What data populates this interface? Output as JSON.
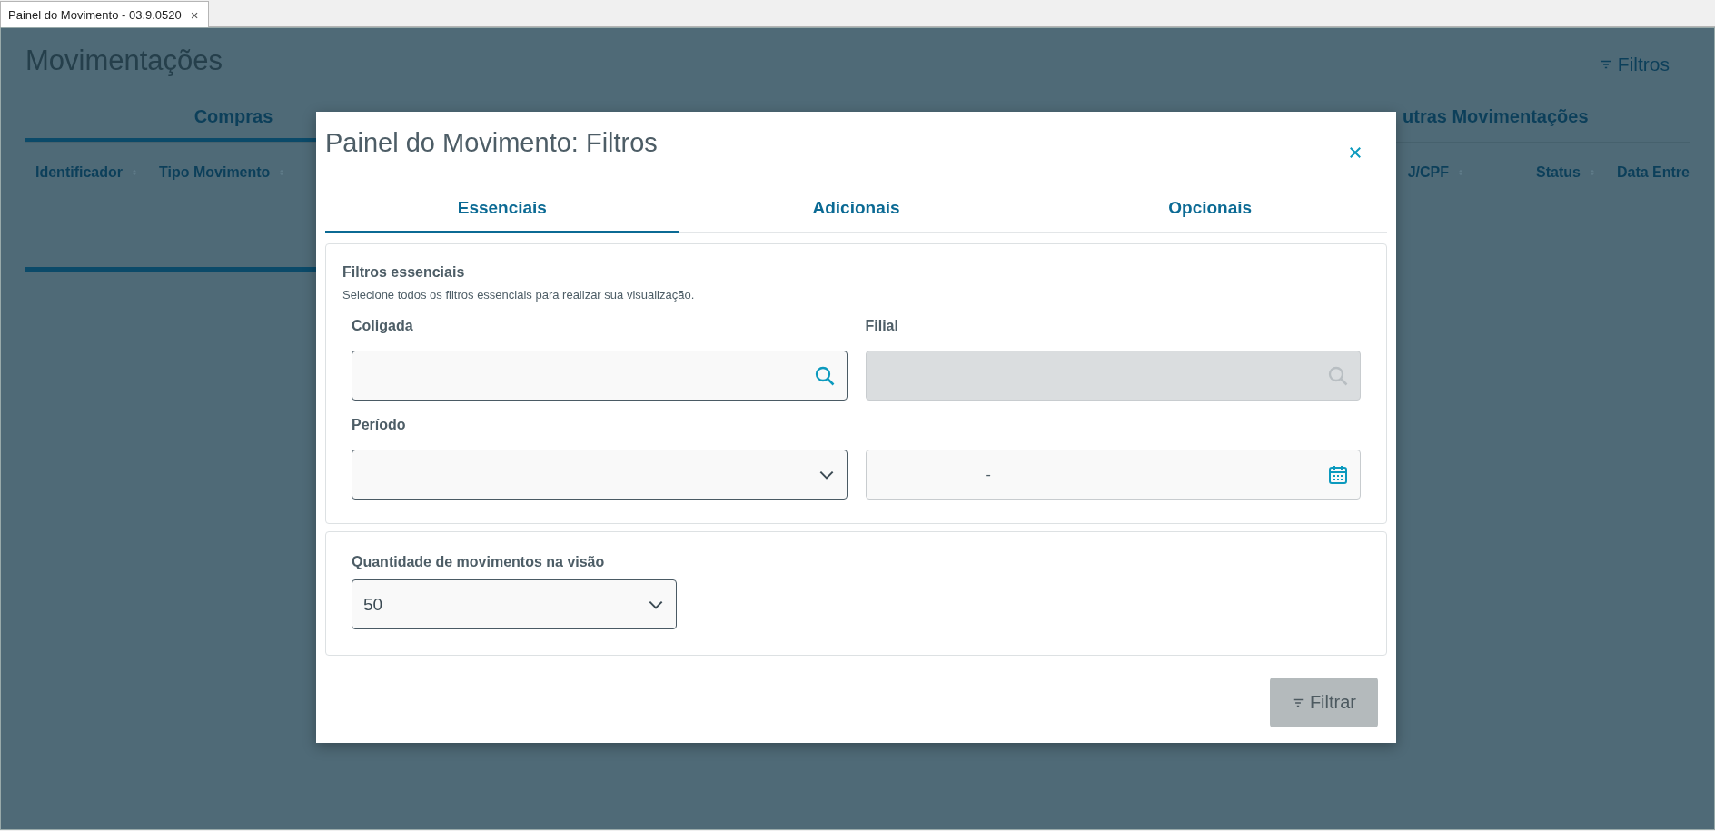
{
  "window": {
    "tab": {
      "title": "Painel do Movimento - 03.9.0520",
      "close": "×",
      "selected": true
    }
  },
  "page": {
    "title": "Movimentações",
    "filters_button": "Filtros",
    "tabs": [
      {
        "label": "Compras",
        "selected": true
      },
      {
        "label": "utras Movimentações",
        "selected": false
      }
    ],
    "columns_left": [
      "Identificador",
      "Tipo Movimento"
    ],
    "columns_right": [
      "J/CPF",
      "Status",
      "Data Entre"
    ]
  },
  "dialog": {
    "title": "Painel do Movimento: Filtros",
    "tabs": [
      {
        "label": "Essenciais",
        "selected": true
      },
      {
        "label": "Adicionais",
        "selected": false
      },
      {
        "label": "Opcionais",
        "selected": false
      }
    ],
    "section": {
      "title": "Filtros essenciais",
      "description": "Selecione todos os filtros essenciais para realizar sua visualização.",
      "fields": [
        {
          "kind": "lookup",
          "label": "Coligada",
          "disabled": false
        },
        {
          "kind": "lookup",
          "label": "Filial",
          "disabled": true
        },
        {
          "kind": "select",
          "label": "Período"
        },
        {
          "kind": "daterange",
          "separator": "-"
        }
      ]
    },
    "quantity": {
      "label": "Quantidade de movimentos na visão",
      "value": "50"
    },
    "submit": {
      "label": "Filtrar",
      "disabled": true
    }
  }
}
